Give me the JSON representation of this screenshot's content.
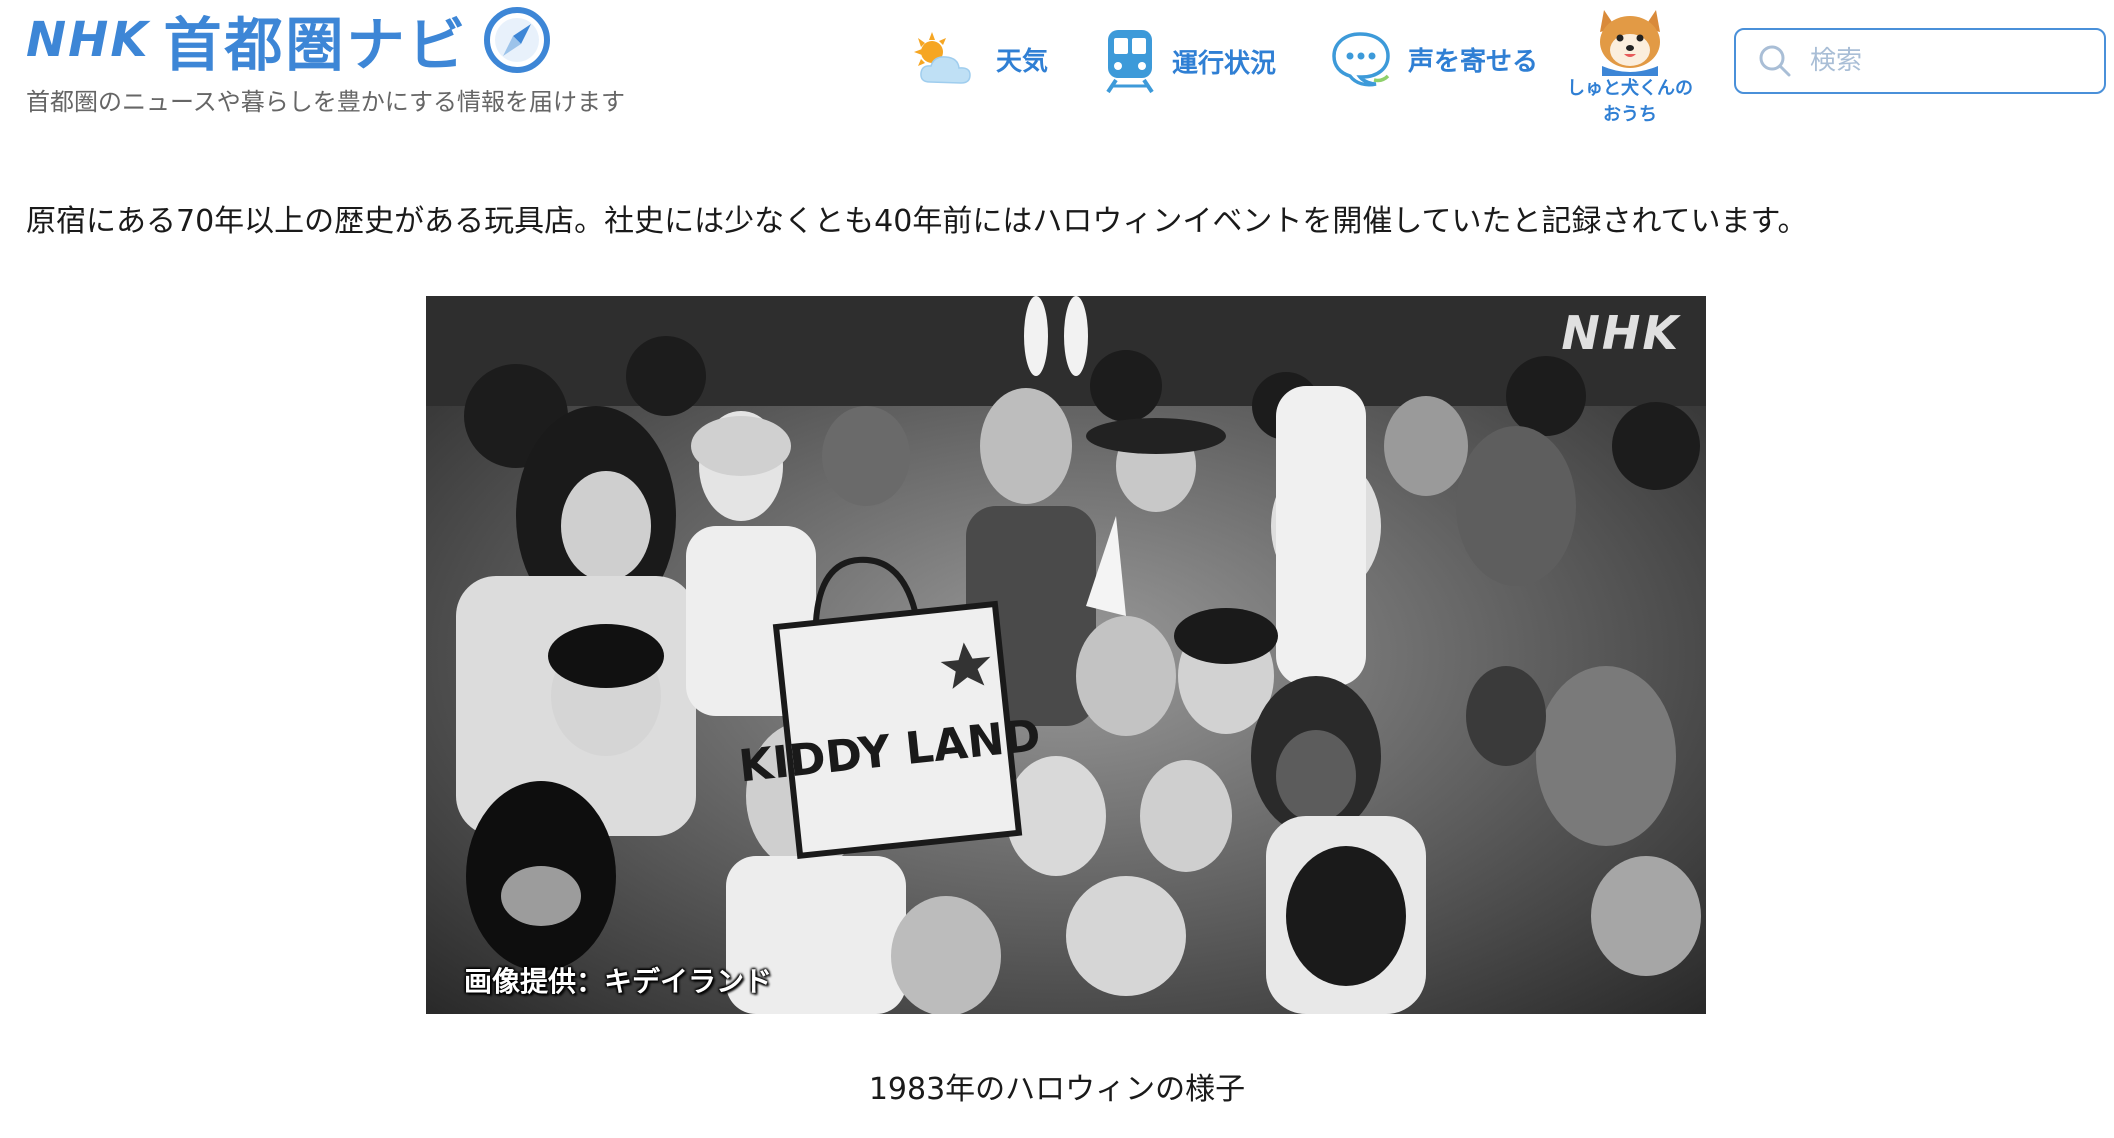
{
  "header": {
    "brand_nhk": "NHK",
    "brand_title": "首都圏ナビ",
    "tagline": "首都圏のニュースや暮らしを豊かにする情報を届けます"
  },
  "nav": {
    "weather": {
      "label": "天気",
      "icon": "weather-icon"
    },
    "traffic": {
      "label": "運行状況",
      "icon": "train-icon"
    },
    "voice": {
      "label": "声を寄せる",
      "icon": "chat-bubble-icon"
    },
    "shuto": {
      "label_line1": "しゅと犬くんの",
      "label_line2": "おうち",
      "icon": "shiba-dog-icon"
    }
  },
  "search": {
    "placeholder": "検索",
    "value": ""
  },
  "article": {
    "lead": "原宿にある70年以上の歴史がある玩具店。社史には少なくとも40年前にはハロウィンイベントを開催していたと記録されています。",
    "photo": {
      "watermark": "NHK",
      "bag_text": "KIDDY LAND",
      "credit": "画像提供：キデイランド"
    },
    "caption": "1983年のハロウィンの様子"
  },
  "colors": {
    "accent": "#3d86d6",
    "nav_text": "#2f7fd4",
    "search_border": "#4a90d9"
  }
}
